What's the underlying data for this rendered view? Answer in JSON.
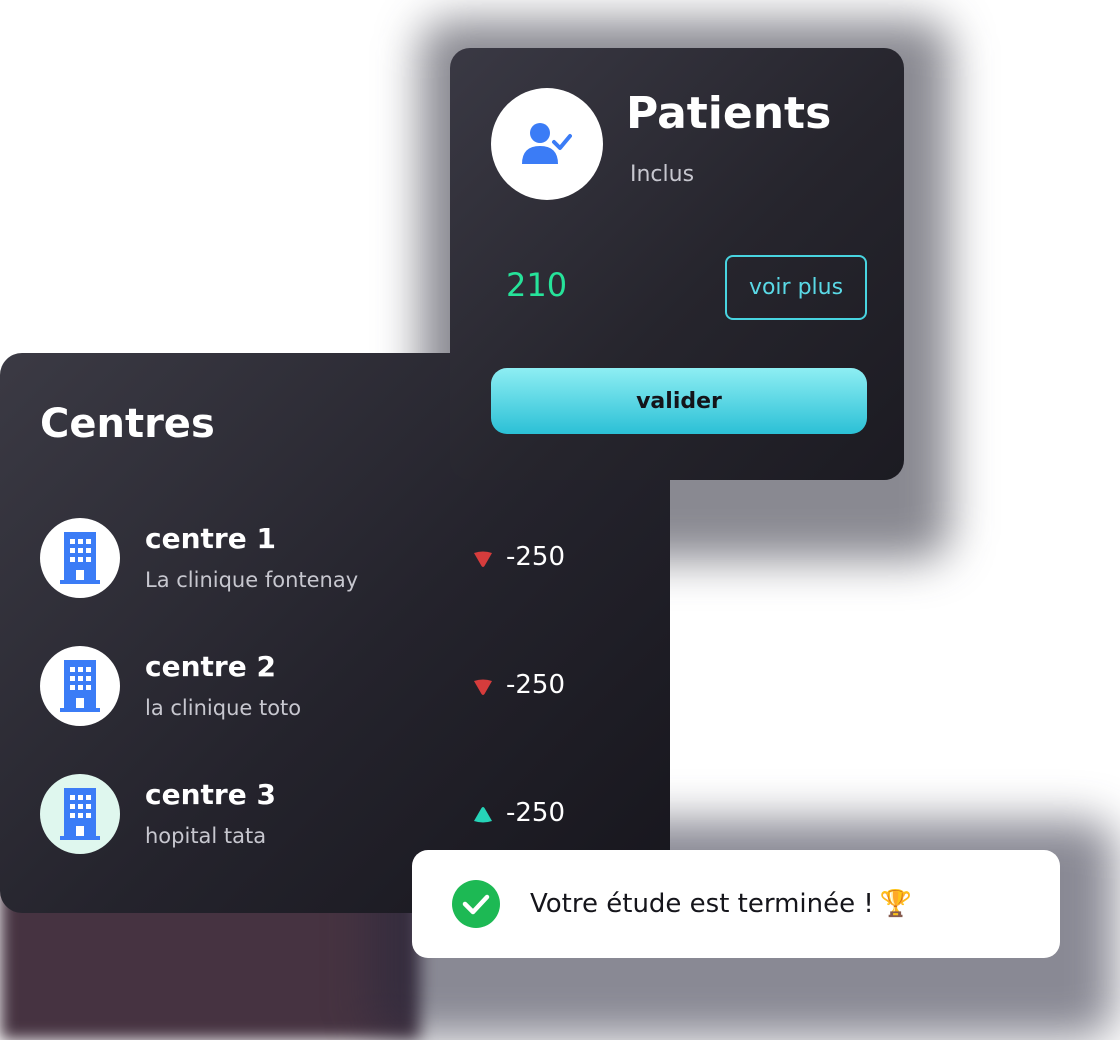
{
  "patients": {
    "title": "Patients",
    "subtitle": "Inclus",
    "count": "210",
    "voir_plus_label": "voir plus",
    "valider_label": "valider",
    "icon": "user-check-icon"
  },
  "centres": {
    "title": "Centres",
    "items": [
      {
        "name": "centre 1",
        "subtitle": "La clinique fontenay",
        "value": "-250",
        "trend": "down",
        "icon": "building-icon",
        "trend_color": "#d63c3c"
      },
      {
        "name": "centre 2",
        "subtitle": "la clinique toto",
        "value": "-250",
        "trend": "down",
        "icon": "building-icon",
        "trend_color": "#d63c3c"
      },
      {
        "name": "centre 3",
        "subtitle": "hopital tata",
        "value": "-250",
        "trend": "up",
        "icon": "building-icon",
        "trend_color": "#26d4b8"
      }
    ]
  },
  "toast": {
    "message": "Votre étude est terminée !",
    "emoji": "🏆",
    "icon": "check-circle-icon"
  },
  "colors": {
    "accent_cyan": "#48d4e0",
    "count_green": "#26e39a",
    "icon_blue": "#3b7cf6",
    "success_green": "#1db954"
  }
}
